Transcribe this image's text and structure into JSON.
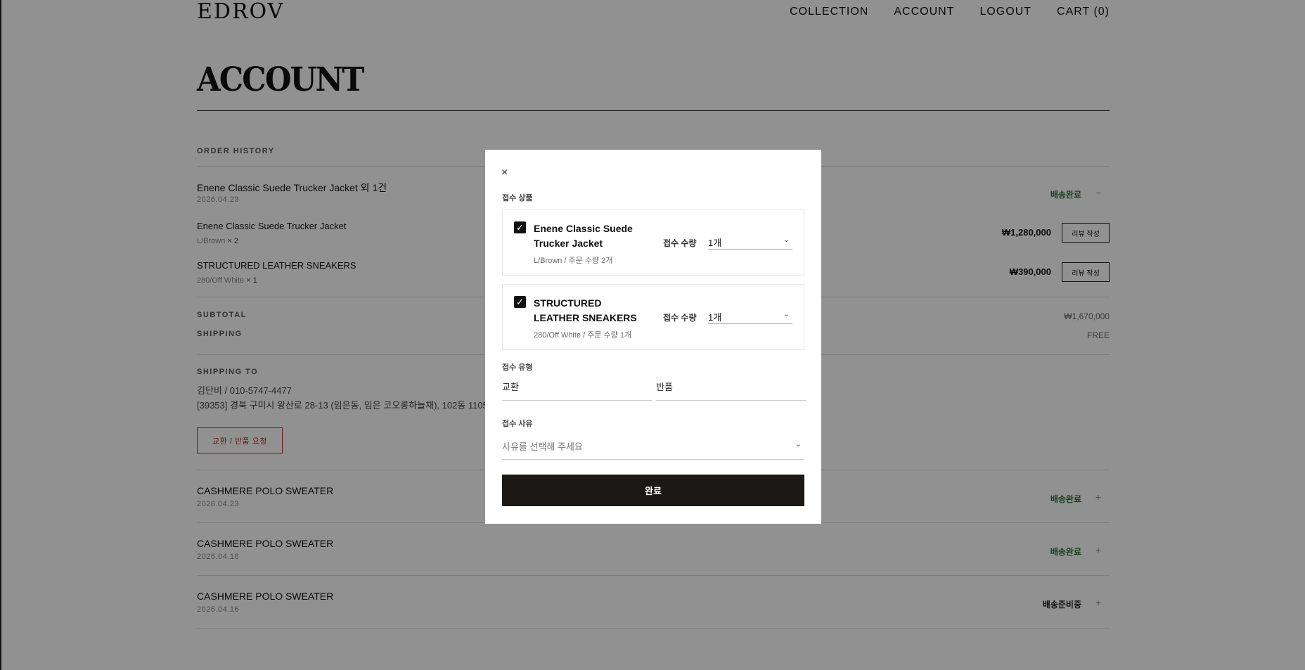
{
  "header": {
    "logo": "EDROV",
    "nav": [
      "COLLECTION",
      "ACCOUNT",
      "LOGOUT",
      "CART (0)"
    ]
  },
  "page_title": "ACCOUNT",
  "order_history": {
    "label": "ORDER HISTORY",
    "expanded_order": {
      "title": "Enene Classic Suede Trucker Jacket 외 1건",
      "date": "2026.04.23",
      "status": "배송완료",
      "toggle": "−",
      "items": [
        {
          "name": "Enene Classic Suede Trucker Jacket",
          "option": "L/Brown",
          "qty": "× 2",
          "price": "₩1,280,000",
          "review": "리뷰 작성"
        },
        {
          "name": "STRUCTURED LEATHER SNEAKERS",
          "option": "280/Off White",
          "qty": "× 1",
          "price": "₩390,000",
          "review": "리뷰 작성"
        }
      ],
      "subtotal_label": "SUBTOTAL",
      "subtotal_value": "₩1,670,000",
      "shipping_label": "SHIPPING",
      "shipping_value": "FREE",
      "shipping_to_label": "SHIPPING TO",
      "recipient": "김단비 / 010-5747-4477",
      "address": "[39353] 경북 구미시 왕산로 28-13 (임은동, 임은 코오롱하늘채), 102동 1105",
      "return_button": "교환 / 반품 요청"
    },
    "orders": [
      {
        "title": "CASHMERE POLO SWEATER",
        "date": "2026.04.23",
        "status": "배송완료",
        "toggle": "+"
      },
      {
        "title": "CASHMERE POLO SWEATER",
        "date": "2026.04.16",
        "status": "배송완료",
        "toggle": "+"
      },
      {
        "title": "CASHMERE POLO SWEATER",
        "date": "2026.04.16",
        "status": "배송준비중",
        "toggle": "+"
      }
    ]
  },
  "modal": {
    "close_icon": "×",
    "items_label": "접수 상품",
    "items": [
      {
        "checked": "✓",
        "name": "Enene Classic Suede Trucker Jacket",
        "option": "L/Brown / 주문 수량 2개",
        "qty_label": "접수 수량",
        "qty_value": "1개"
      },
      {
        "checked": "✓",
        "name": "STRUCTURED LEATHER SNEAKERS",
        "option": "280/Off White / 주문 수량 1개",
        "qty_label": "접수 수량",
        "qty_value": "1개"
      }
    ],
    "chevron": "⌄",
    "type_label": "접수 유형",
    "type_options": [
      "교환",
      "반품"
    ],
    "reason_label": "접수 사유",
    "reason_placeholder": "사유를 선택해 주세요",
    "confirm_button": "완료"
  }
}
